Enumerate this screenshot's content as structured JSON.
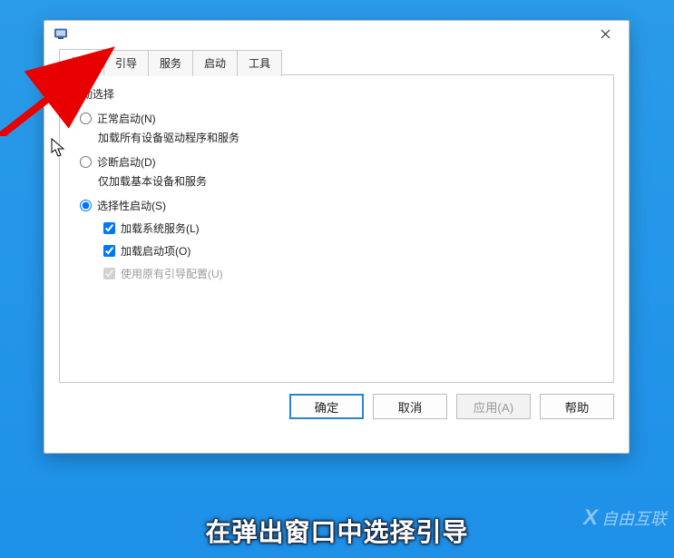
{
  "window": {
    "close_tooltip": "关闭"
  },
  "tabs": [
    "常规",
    "引导",
    "服务",
    "启动",
    "工具"
  ],
  "active_tab_index": 0,
  "panel": {
    "group_title": "启动选择",
    "options": {
      "normal": {
        "label": "正常启动(N)",
        "desc": "加载所有设备驱动程序和服务"
      },
      "diagnostic": {
        "label": "诊断启动(D)",
        "desc": "仅加载基本设备和服务"
      },
      "selective": {
        "label": "选择性启动(S)"
      }
    },
    "selected_option": "selective",
    "selective_checks": {
      "load_services": {
        "label": "加载系统服务(L)",
        "checked": true,
        "disabled": false
      },
      "load_startup": {
        "label": "加载启动项(O)",
        "checked": true,
        "disabled": false
      },
      "use_boot_cfg": {
        "label": "使用原有引导配置(U)",
        "checked": true,
        "disabled": true
      }
    }
  },
  "buttons": {
    "ok": "确定",
    "cancel": "取消",
    "apply": "应用(A)",
    "help": "帮助"
  },
  "caption": "在弹出窗口中选择引导",
  "watermark": {
    "x": "X",
    "text": "自由互联"
  }
}
